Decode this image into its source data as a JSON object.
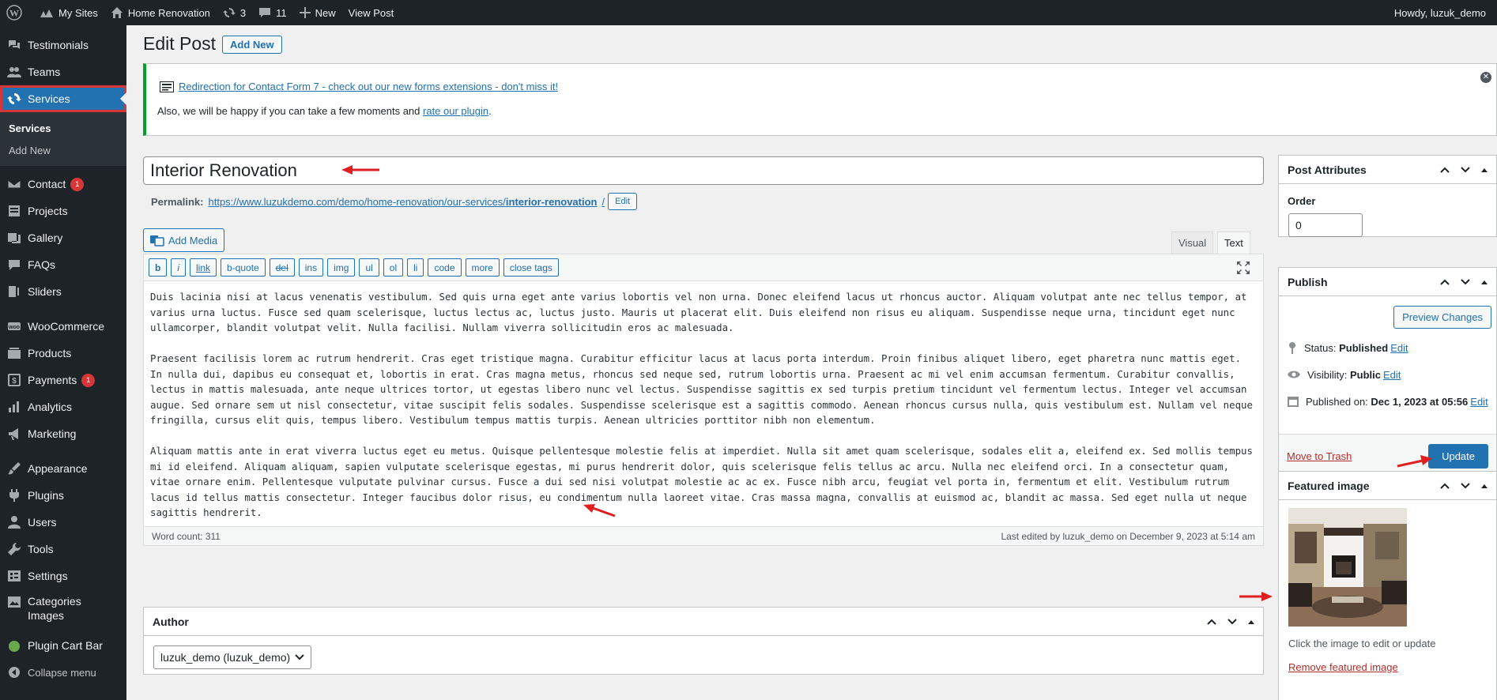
{
  "admin_bar": {
    "my_sites": "My Sites",
    "site_name": "Home Renovation",
    "updates_count": "3",
    "comments_count": "11",
    "new_label": "New",
    "view_post": "View Post",
    "howdy": "Howdy, luzuk_demo"
  },
  "sidebar": {
    "items_top": [
      {
        "label": "Testimonials",
        "icon": "testimonial-icon"
      },
      {
        "label": "Teams",
        "icon": "teams-icon"
      }
    ],
    "current": {
      "label": "Services",
      "icon": "services-icon"
    },
    "submenu": [
      {
        "label": "Services",
        "active": true
      },
      {
        "label": "Add New",
        "active": false
      }
    ],
    "contact": {
      "label": "Contact",
      "badge": "1"
    },
    "projects": "Projects",
    "gallery": "Gallery",
    "faqs": "FAQs",
    "sliders": "Sliders",
    "woocommerce": "WooCommerce",
    "products": "Products",
    "payments": {
      "label": "Payments",
      "badge": "1"
    },
    "analytics": "Analytics",
    "marketing": "Marketing",
    "appearance": "Appearance",
    "plugins": "Plugins",
    "users": "Users",
    "tools": "Tools",
    "settings": "Settings",
    "categories_images": "Categories Images",
    "plugin_cart_bar": "Plugin Cart Bar",
    "collapse": "Collapse menu"
  },
  "page": {
    "title": "Edit Post",
    "add_new": "Add New"
  },
  "notice": {
    "link": "Redirection for Contact Form 7 - check out our new forms extensions - don't miss it!",
    "text_before": "Also, we will be happy if you can take a few moments and ",
    "rate_link": "rate our plugin",
    "text_after": "."
  },
  "post": {
    "title": "Interior Renovation",
    "permalink_label": "Permalink:",
    "permalink_base": "https://www.luzukdemo.com/demo/home-renovation/our-services/",
    "permalink_slug": "interior-renovation",
    "permalink_end": "/",
    "edit_label": "Edit"
  },
  "editor": {
    "add_media": "Add Media",
    "tab_visual": "Visual",
    "tab_text": "Text",
    "quicktags": [
      "b",
      "i",
      "link",
      "b-quote",
      "del",
      "ins",
      "img",
      "ul",
      "ol",
      "li",
      "code",
      "more",
      "close tags"
    ],
    "paragraphs": [
      "Duis lacinia nisi at lacus venenatis vestibulum. Sed quis urna eget ante varius lobortis vel non urna. Donec eleifend lacus ut rhoncus auctor. Aliquam volutpat ante nec tellus tempor, at varius urna luctus. Fusce sed quam scelerisque, luctus lectus ac, luctus justo. Mauris ut placerat elit. Duis eleifend non risus eu aliquam. Suspendisse neque urna, tincidunt eget nunc ullamcorper, blandit volutpat velit. Nulla facilisi. Nullam viverra sollicitudin eros ac malesuada.",
      "Praesent facilisis lorem ac rutrum hendrerit. Cras eget tristique magna. Curabitur efficitur lacus at lacus porta interdum. Proin finibus aliquet libero, eget pharetra nunc mattis eget. In nulla dui, dapibus eu consequat et, lobortis in erat. Cras magna metus, rhoncus sed neque sed, rutrum lobortis urna. Praesent ac mi vel enim accumsan fermentum. Curabitur convallis, lectus in mattis malesuada, ante neque ultrices tortor, ut egestas libero nunc vel lectus. Suspendisse sagittis ex sed turpis pretium tincidunt vel fermentum lectus. Integer vel accumsan augue. Sed ornare sem ut nisl consectetur, vitae suscipit felis sodales. Suspendisse scelerisque est a sagittis commodo. Aenean rhoncus cursus nulla, quis vestibulum est. Nullam vel neque fringilla, cursus elit quis, tempus libero. Vestibulum tempus mattis turpis. Aenean ultricies porttitor nibh non elementum.",
      "Aliquam mattis ante in erat viverra luctus eget eu metus. Quisque pellentesque molestie felis at imperdiet. Nulla sit amet quam scelerisque, sodales elit a, eleifend ex. Sed mollis tempus mi id eleifend. Aliquam aliquam, sapien vulputate scelerisque egestas, mi purus hendrerit dolor, quis scelerisque felis tellus ac arcu. Nulla nec eleifend orci. In a consectetur quam, vitae ornare enim. Pellentesque vulputate pulvinar cursus. Fusce a dui sed nisi volutpat molestie ac ac ex. Fusce nibh arcu, feugiat vel porta in, fermentum et elit. Vestibulum rutrum lacus id tellus mattis consectetur. Integer faucibus dolor risus, eu condimentum nulla laoreet vitae. Cras massa magna, convallis at euismod ac, blandit ac massa. Sed eget nulla ut neque sagittis hendrerit."
    ],
    "word_count": "Word count: 311",
    "last_edited": "Last edited by luzuk_demo on December 9, 2023 at 5:14 am"
  },
  "author_box": {
    "title": "Author",
    "selected": "luzuk_demo (luzuk_demo)"
  },
  "attributes_box": {
    "title": "Post Attributes",
    "order_label": "Order",
    "order_value": "0"
  },
  "publish_box": {
    "title": "Publish",
    "preview": "Preview Changes",
    "status_label": "Status:",
    "status_value": "Published",
    "visibility_label": "Visibility:",
    "visibility_value": "Public",
    "published_label": "Published on:",
    "published_value": "Dec 1, 2023 at 05:56",
    "edit": "Edit",
    "trash": "Move to Trash",
    "update": "Update"
  },
  "featured_box": {
    "title": "Featured image",
    "help": "Click the image to edit or update",
    "remove": "Remove featured image"
  },
  "colors": {
    "accent": "#2271b1",
    "admin_dark": "#1d2327",
    "annotation_red": "#e02020"
  }
}
